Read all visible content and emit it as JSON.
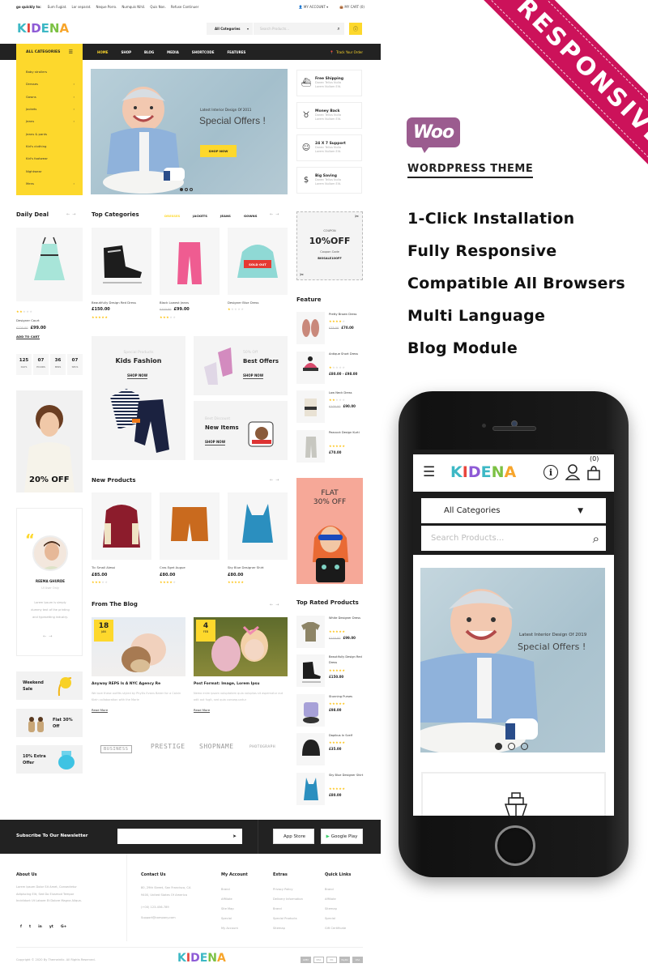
{
  "site": {
    "topbar": {
      "quick_label": "go quickly to:",
      "quick_links": [
        "Eum Fugiat.",
        "Lor separat.",
        "Neque Porro.",
        "Numquis Nihil.",
        "Quis Non.",
        "Refuse Continuer"
      ],
      "account": "MY ACCOUNT",
      "cart": "MY CART (0)"
    },
    "logo": [
      "K",
      "I",
      "D",
      "E",
      "N",
      "A"
    ],
    "logo_colors": [
      "#3db8c5",
      "#e8453c",
      "#8e5bd6",
      "#3db8c5",
      "#7cc144",
      "#f7a52b"
    ],
    "search": {
      "category": "All Categories",
      "placeholder": "Search Products..."
    },
    "nav": {
      "all_categories": "ALL CATEGORIES",
      "items": [
        "HOME",
        "SHOP",
        "BLOG",
        "MEDIA",
        "SHORTCODE",
        "FEATURES"
      ],
      "active": "HOME",
      "track": "Track Your Order"
    },
    "categories": [
      {
        "label": "Baby strollers",
        "arrow": false
      },
      {
        "label": "Dresses",
        "arrow": true
      },
      {
        "label": "Gowns",
        "arrow": true
      },
      {
        "label": "Jackets",
        "arrow": true
      },
      {
        "label": "Jeans",
        "arrow": true
      },
      {
        "label": "Jeans & pants",
        "arrow": false
      },
      {
        "label": "Kid's clothing",
        "arrow": false
      },
      {
        "label": "Kid's footwear",
        "arrow": false
      },
      {
        "label": "Nightwear",
        "arrow": false
      },
      {
        "label": "Mens",
        "arrow": true
      }
    ],
    "hero": {
      "subtitle": "Latest Interior Design Of 2011",
      "title": "Special Offers !",
      "button": "SHOP NOW"
    },
    "services": [
      {
        "icon": "ship-icon",
        "glyph": "⛴",
        "title": "Free Shipping",
        "desc1": "Donec Tellus Nulla",
        "desc2": "Lorem Nullam Elit."
      },
      {
        "icon": "piggy-bank-icon",
        "glyph": "🐖",
        "title": "Money Back",
        "desc1": "Donec Tellus Nulla",
        "desc2": "Lorem Nullam Elit."
      },
      {
        "icon": "support-agent-icon",
        "glyph": "☺",
        "title": "24 X 7 Support",
        "desc1": "Donec Tellus Nulla",
        "desc2": "Lorem Nullam Elit."
      },
      {
        "icon": "money-hand-icon",
        "glyph": "$",
        "title": "Big Saving",
        "desc1": "Donec Tellus Nulla",
        "desc2": "Lorem Nullam Elit."
      }
    ],
    "daily_deal": {
      "heading": "Daily Deal",
      "product": "Designer Court",
      "old_price": "£120.00",
      "price": "£99.00",
      "rating": 2,
      "add_to_cart": "ADD TO CART",
      "countdown": [
        {
          "value": "125",
          "unit": "DAYS"
        },
        {
          "value": "07",
          "unit": "HOURS"
        },
        {
          "value": "36",
          "unit": "MINS"
        },
        {
          "value": "07",
          "unit": "SECS"
        }
      ]
    },
    "top_categories": {
      "heading": "Top Categories",
      "tabs": [
        "DRESSES",
        "JACKETS",
        "JEANS",
        "GOWNS"
      ],
      "active_tab": "DRESSES",
      "products": [
        {
          "name": "Beautifully Design Red Dress",
          "old_price": "",
          "price": "£150.00",
          "rating": 5,
          "badge": ""
        },
        {
          "name": "Black Lowest Jeans",
          "old_price": "£110.00",
          "price": "£99.00",
          "rating": 3,
          "badge": ""
        },
        {
          "name": "Designer Blue Dress",
          "old_price": "",
          "price": "",
          "rating": 1,
          "badge": "SOLD OUT"
        }
      ]
    },
    "coupon": {
      "label": "COUPON",
      "value": "10%OFF",
      "code_label": "Coupon Code",
      "code": "BIOSALE10OFF"
    },
    "feature": {
      "heading": "Feature",
      "items": [
        {
          "name": "Pretty Brown Dress",
          "rating": 4,
          "old_price": "£75.00",
          "price": "£70.00"
        },
        {
          "name": "Antique Short Dress",
          "rating": 1,
          "old_price": "",
          "price": "£80.00 - £98.00"
        },
        {
          "name": "Low Neck Dress",
          "rating": 2,
          "old_price": "£100.00",
          "price": "£90.00"
        },
        {
          "name": "Peacock Design Kurti",
          "rating": 5,
          "old_price": "",
          "price": "£70.00"
        }
      ]
    },
    "tiles": {
      "kids": {
        "sub": "Special Products",
        "title": "Kids Fashion",
        "link": "SHOP NOW"
      },
      "best": {
        "sub": "50% Off",
        "title": "Best Offers",
        "link": "SHOP NOW"
      },
      "new": {
        "sub": "Best Discount",
        "title": "New Items",
        "link": "SHOP NOW"
      }
    },
    "boy_banner": "20% OFF",
    "new_products": {
      "heading": "New Products",
      "products": [
        {
          "name": "Tic Small Alessi",
          "price": "£85.00",
          "rating": 3
        },
        {
          "name": "Cras Eget Augue",
          "price": "£80.00",
          "rating": 4
        },
        {
          "name": "Sky Blue Designer Shirt",
          "price": "£80.00",
          "rating": 5
        }
      ]
    },
    "flat_banner": {
      "line1": "FLAT",
      "line2": "30% OFF"
    },
    "testimonial": {
      "name": "REEMA GHURDE",
      "role": "UI User Only",
      "text": [
        "Lorem Ipsum is simply",
        "dummy text of the printing",
        "and typesetting industry."
      ]
    },
    "blog": {
      "heading": "From The Blog",
      "posts": [
        {
          "day": "18",
          "month": "JAN",
          "title": "Anyway REPS Is A NYC Agency Re",
          "desc": "We love these outfits styled by Phyllis Evans Baker for a Calvin Klein collaboration with the Marie",
          "more": "Read More"
        },
        {
          "day": "4",
          "month": "FEB",
          "title": "Post Format: Image, Lorem Ipsu",
          "desc": "Nemo enim ipsam voluptatem quia voluptas sit aspernatur aut odit aut fugit, sed quia consequuntur",
          "more": "Read More"
        }
      ]
    },
    "promos": [
      {
        "title": "Weekend Sale"
      },
      {
        "title": "Flat 30% Off"
      },
      {
        "title": "10% Extra Offer"
      }
    ],
    "brands": [
      "BUSINESS",
      "PRESTIGE",
      "SHOPNAME",
      "PHOTOGRAPH"
    ],
    "top_rated": {
      "heading": "Top Rated Products",
      "items": [
        {
          "name": "White Designer Dress",
          "rating": 5,
          "old_price": "£115.00",
          "price": "£99.00"
        },
        {
          "name": "Beautifully Design Red Dress",
          "rating": 5,
          "old_price": "",
          "price": "£150.00"
        },
        {
          "name": "Stunning Purses",
          "rating": 5,
          "old_price": "",
          "price": "£98.00"
        },
        {
          "name": "Dapibus In Scelf",
          "rating": 5,
          "old_price": "",
          "price": "£35.00"
        },
        {
          "name": "Sky Blue Designer Shirt",
          "rating": 5,
          "old_price": "",
          "price": "£80.00"
        }
      ]
    },
    "newsletter": {
      "label": "Subscribe To Our Newsletter",
      "app_store": "App Store",
      "google_play": "Google Play"
    },
    "footer": {
      "about": {
        "heading": "About Us",
        "text": [
          "Lorem Ipsum Dolor Sit Amet, Consectetur",
          "Adipiscing Elit, Sed Do Eiusmod Tempor",
          "Incididunt Ut Labore Et Dolore Magna Aliqua."
        ]
      },
      "social": [
        "f",
        "t",
        "in",
        "yt",
        "G+"
      ],
      "contact": {
        "heading": "Contact Us",
        "address": [
          "80, 29th Street, San Francisco, CA",
          "9400, United States Of America"
        ],
        "phone": "(+00) 123-456-789",
        "email": "Support@company.com"
      },
      "my_account": {
        "heading": "My Account",
        "links": [
          "Brand",
          "Affiliate",
          "Site Map",
          "Special",
          "My Account"
        ]
      },
      "extras": {
        "heading": "Extras",
        "links": [
          "Privacy Policy",
          "Delivery Information",
          "Brand",
          "Special Products",
          "Sitemap"
        ]
      },
      "quick_links": {
        "heading": "Quick Links",
        "links": [
          "Brand",
          "Affiliate",
          "Sitemap",
          "Special",
          "Gift Certificate"
        ]
      },
      "copyright": "Copyright © 2020 By Themeintic. All Rights Reserved.",
      "payments": [
        "AMEX",
        "DISC",
        "MC",
        "PayPal",
        "VISA"
      ]
    }
  },
  "promo_panel": {
    "ribbon": "RESPONSIVE",
    "woo": "Woo",
    "subtitle": "WORDPRESS THEME",
    "features": [
      "1-Click Installation",
      "Fully Responsive",
      "Compatible All Browsers",
      "Multi Language",
      "Blog Module"
    ],
    "colors": {
      "ribbon": "#cc125a",
      "woo": "#9b5c8f",
      "accent": "#fdd82c"
    }
  },
  "mobile": {
    "cart_count": "(0)",
    "category": "All Categories",
    "search_placeholder": "Search Products...",
    "hero_subtitle": "Latest Interior Design Of 2019",
    "hero_title": "Special Offers !"
  }
}
